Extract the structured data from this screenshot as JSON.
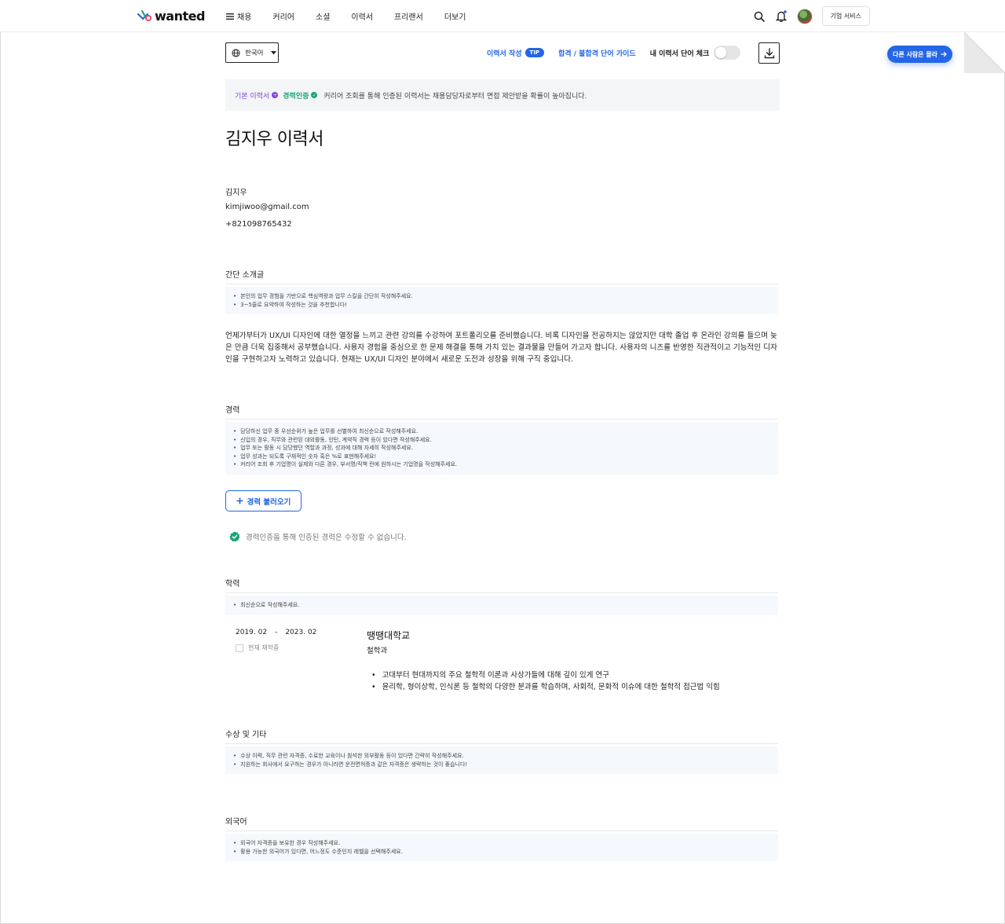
{
  "nav": {
    "logo_text": "wanted",
    "menu": [
      "채용",
      "커리어",
      "소셜",
      "이력서",
      "프리랜서",
      "더보기"
    ],
    "corp_service": "기업 서비스"
  },
  "toolbar": {
    "language": "한국어",
    "resume_tip_label": "이력서 작성",
    "tip_badge": "TIP",
    "guide_label": "합격 / 불합격 단어 가이드",
    "word_check_label": "내 이력서 단어 체크",
    "ask_others": "다른 사람은 몰라"
  },
  "banner": {
    "basic": "기본 이력서",
    "cert": "경력인증",
    "text": "커리어 조회를 통해 인증된 이력서는 채용담당자로부터 면접 제안받을 확률이 높아집니다."
  },
  "resume": {
    "title": "김지우 이력서",
    "name": "김지우",
    "email": "kimjiwoo@gmail.com",
    "phone": "+821098765432"
  },
  "intro": {
    "header": "간단 소개글",
    "guide": [
      "본인의 업무 경험을 기반으로 핵심역량과 업무 스킬을 간단히 작성해주세요.",
      "3~5줄로 요약하여 작성하는 것을 추천합니다!"
    ],
    "text": "언제가부터가 UX/UI 디자인에 대한 열정을 느끼고 관련 강의를 수강하여 포트폴리오를 준비했습니다. 비록 디자인을 전공하지는 않았지만 대학 졸업 후 온라인 강의를 들으며 늦은 만큼 더욱 집중해서 공부했습니다. 사용자 경험을 중심으로 한 문제 해결을 통해 가치 있는 결과물을 만들어 가고자 합니다. 사용자의 니즈를 반영한 직관적이고 기능적인 디자인을 구현하고자 노력하고 있습니다. 현재는 UX/UI 디자인 분야에서 새로운 도전과 성장을 위해 구직 중입니다."
  },
  "career": {
    "header": "경력",
    "guide": [
      "담당하신 업무 중 우선순위가 높은 업무를 선별하여 최신순으로 작성해주세요.",
      "신입의 경우, 직무와 관련된 대외활동, 인턴, 계약직 경력 등이 있다면 작성해주세요.",
      "업무 또는 활동 시 담당했던 역할과 과정, 성과에 대해 자세히 작성해주세요.",
      "업무 성과는 되도록 구체적인 숫자 혹은 %로 표현해주세요!",
      "커리어 조회 후 기업명이 실제와 다른 경우, 부서명/직책 란에 원하시는 기업명을 작성해주세요."
    ],
    "load_button": "경력 불러오기",
    "verified_note": "경력인증을 통해 인증된 경력은 수정할 수 없습니다."
  },
  "education": {
    "header": "학력",
    "guide": [
      "최신순으로 작성해주세요."
    ],
    "start": "2019. 02",
    "dash": "-",
    "end": "2023. 02",
    "enrolled_label": "현재 재학중",
    "school": "땡땡대학교",
    "major": "철학과",
    "details": [
      "고대부터 현대까지의 주요 철학적 이론과 사상가들에 대해 깊이 있게 연구",
      "윤리학, 형이상학, 인식론 등 철학의 다양한 분과를 학습하며, 사회적, 문화적 이슈에 대한 철학적 접근법 익힘"
    ]
  },
  "awards": {
    "header": "수상 및 기타",
    "guide": [
      "수상 이력, 직무 관련 자격증, 수료한 교육이나 참석한 외부활동 등이 있다면 간략히 작성해주세요.",
      "지원하는 회사에서 요구하는 경우가 아니라면 운전면허증과 같은 자격증은 생략하는 것이 좋습니다!"
    ]
  },
  "language": {
    "header": "외국어",
    "guide": [
      "외국어 자격증을 보유한 경우 작성해주세요.",
      "활용 가능한 외국어가 있다면, 어느정도 수준인지 레벨을 선택해주세요."
    ]
  },
  "colors": {
    "accent": "#2466e6",
    "verified": "#1aa37a",
    "basic": "#7c45d6"
  }
}
